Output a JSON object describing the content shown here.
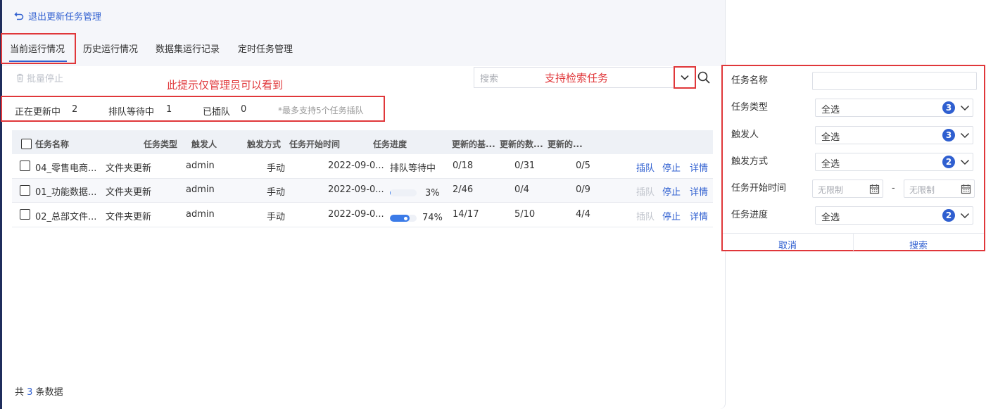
{
  "header": {
    "back_label": "退出更新任务管理"
  },
  "tabs": [
    {
      "label": "当前运行情况",
      "active": true
    },
    {
      "label": "历史运行情况"
    },
    {
      "label": "数据集运行记录"
    },
    {
      "label": "定时任务管理"
    }
  ],
  "toolbar": {
    "batch_stop_label": "批量停止",
    "admin_note": "此提示仅管理员可以看到",
    "search_placeholder": "搜索",
    "search_note": "支持检索任务"
  },
  "stats": {
    "updating_label": "正在更新中",
    "updating_count": "2",
    "queued_label": "排队等待中",
    "queued_count": "1",
    "inserted_label": "已插队",
    "inserted_count": "0",
    "note": "*最多支持5个任务插队"
  },
  "table": {
    "columns": [
      "任务名称",
      "任务类型",
      "触发人",
      "触发方式",
      "任务开始时间",
      "任务进度",
      "更新的基...",
      "更新的数...",
      "更新的..."
    ],
    "rows": [
      {
        "name": "04_零售电商...",
        "type": "文件夹更新",
        "trigger_user": "admin",
        "trigger_mode": "手动",
        "start_time": "2022-09-0...",
        "progress_text": "排队等待中",
        "c1": "0/18",
        "c2": "0/31",
        "c3": "0/5",
        "insert": "插队",
        "insert_enabled": true,
        "stop": "停止",
        "detail": "详情"
      },
      {
        "name": "01_功能数据...",
        "type": "文件夹更新",
        "trigger_user": "admin",
        "trigger_mode": "手动",
        "start_time": "2022-09-0...",
        "progress": 3,
        "progress_text": "3%",
        "c1": "2/46",
        "c2": "0/4",
        "c3": "0/9",
        "insert": "插队",
        "insert_enabled": false,
        "stop": "停止",
        "detail": "详情"
      },
      {
        "name": "02_总部文件...",
        "type": "文件夹更新",
        "trigger_user": "admin",
        "trigger_mode": "手动",
        "start_time": "2022-09-0...",
        "progress": 74,
        "progress_text": "74%",
        "c1": "14/17",
        "c2": "5/10",
        "c3": "4/4",
        "insert": "插队",
        "insert_enabled": false,
        "stop": "停止",
        "detail": "详情"
      }
    ]
  },
  "footer": {
    "prefix": "共",
    "count": "3",
    "suffix": "条数据"
  },
  "filter": {
    "task_name_label": "任务名称",
    "task_type_label": "任务类型",
    "task_type_value": "全选",
    "task_type_count": "3",
    "trigger_user_label": "触发人",
    "trigger_user_value": "全选",
    "trigger_user_count": "3",
    "trigger_mode_label": "触发方式",
    "trigger_mode_value": "全选",
    "trigger_mode_count": "2",
    "start_time_label": "任务开始时间",
    "start_placeholder": "无限制",
    "end_placeholder": "无限制",
    "range_sep": "-",
    "progress_label": "任务进度",
    "progress_value": "全选",
    "progress_count": "2",
    "cancel_label": "取消",
    "search_label": "搜索"
  },
  "colors": {
    "accent": "#2f5fd0",
    "annotation": "#e0373a"
  }
}
